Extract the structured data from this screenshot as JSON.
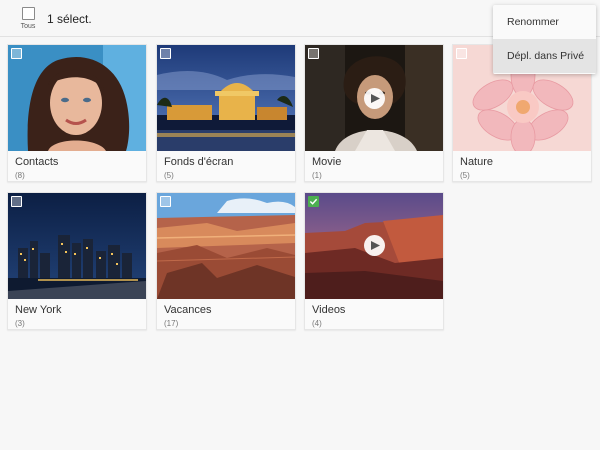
{
  "toolbar": {
    "select_all_label": "Tous",
    "selection_count": "1 sélect."
  },
  "menu": {
    "items": [
      {
        "label": "Renommer"
      },
      {
        "label": "Dépl. dans Privé"
      }
    ]
  },
  "albums": [
    {
      "name": "Contacts",
      "count": "(8)",
      "selected": false,
      "video": false,
      "icon": "portrait-photo"
    },
    {
      "name": "Fonds d'écran",
      "count": "(5)",
      "selected": false,
      "video": false,
      "icon": "palace-night-photo"
    },
    {
      "name": "Movie",
      "count": "(1)",
      "selected": false,
      "video": true,
      "icon": "movie-still-photo"
    },
    {
      "name": "Nature",
      "count": "(5)",
      "selected": false,
      "video": false,
      "icon": "flower-photo"
    },
    {
      "name": "New York",
      "count": "(3)",
      "selected": false,
      "video": false,
      "icon": "city-skyline-photo"
    },
    {
      "name": "Vacances",
      "count": "(17)",
      "selected": false,
      "video": false,
      "icon": "canyon-photo"
    },
    {
      "name": "Videos",
      "count": "(4)",
      "selected": true,
      "video": true,
      "icon": "canyon-sunset-photo"
    }
  ],
  "colors": {
    "check_selected": "#4caf50",
    "background": "#f7f7f7"
  }
}
